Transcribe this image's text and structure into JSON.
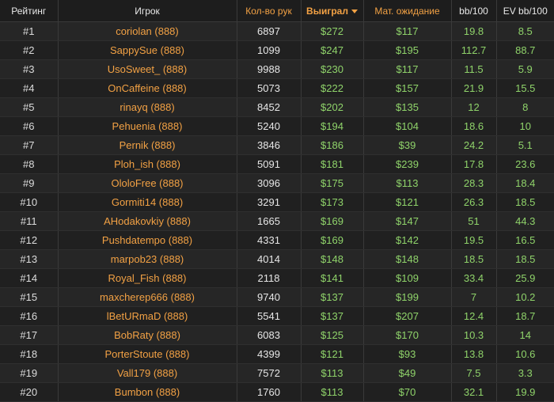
{
  "header": {
    "rank": "Рейтинг",
    "player": "Игрок",
    "hands": "Кол-во рук",
    "won": "Выиграл",
    "expected": "Мат. ожидание",
    "bb100": "bb/100",
    "ev_bb100": "EV bb/100"
  },
  "sort": {
    "column": "won",
    "direction": "desc"
  },
  "colors": {
    "background": "#232323",
    "accent_orange": "#f2a144",
    "money_green": "#8fd36a"
  },
  "rows": [
    {
      "rank": "#1",
      "player": "coriolan (888)",
      "hands": "6897",
      "won": "$272",
      "expected": "$117",
      "bb100": "19.8",
      "ev_bb100": "8.5"
    },
    {
      "rank": "#2",
      "player": "SappySue (888)",
      "hands": "1099",
      "won": "$247",
      "expected": "$195",
      "bb100": "112.7",
      "ev_bb100": "88.7"
    },
    {
      "rank": "#3",
      "player": "UsoSweet_ (888)",
      "hands": "9988",
      "won": "$230",
      "expected": "$117",
      "bb100": "11.5",
      "ev_bb100": "5.9"
    },
    {
      "rank": "#4",
      "player": "OnCaffeine (888)",
      "hands": "5073",
      "won": "$222",
      "expected": "$157",
      "bb100": "21.9",
      "ev_bb100": "15.5"
    },
    {
      "rank": "#5",
      "player": "rinayq (888)",
      "hands": "8452",
      "won": "$202",
      "expected": "$135",
      "bb100": "12",
      "ev_bb100": "8"
    },
    {
      "rank": "#6",
      "player": "Pehuenia (888)",
      "hands": "5240",
      "won": "$194",
      "expected": "$104",
      "bb100": "18.6",
      "ev_bb100": "10"
    },
    {
      "rank": "#7",
      "player": "Pernik (888)",
      "hands": "3846",
      "won": "$186",
      "expected": "$39",
      "bb100": "24.2",
      "ev_bb100": "5.1"
    },
    {
      "rank": "#8",
      "player": "Ploh_ish (888)",
      "hands": "5091",
      "won": "$181",
      "expected": "$239",
      "bb100": "17.8",
      "ev_bb100": "23.6"
    },
    {
      "rank": "#9",
      "player": "OloloFree (888)",
      "hands": "3096",
      "won": "$175",
      "expected": "$113",
      "bb100": "28.3",
      "ev_bb100": "18.4"
    },
    {
      "rank": "#10",
      "player": "Gormiti14 (888)",
      "hands": "3291",
      "won": "$173",
      "expected": "$121",
      "bb100": "26.3",
      "ev_bb100": "18.5"
    },
    {
      "rank": "#11",
      "player": "AHodakovkiy (888)",
      "hands": "1665",
      "won": "$169",
      "expected": "$147",
      "bb100": "51",
      "ev_bb100": "44.3"
    },
    {
      "rank": "#12",
      "player": "Pushdatempo (888)",
      "hands": "4331",
      "won": "$169",
      "expected": "$142",
      "bb100": "19.5",
      "ev_bb100": "16.5"
    },
    {
      "rank": "#13",
      "player": "marpob23 (888)",
      "hands": "4014",
      "won": "$148",
      "expected": "$148",
      "bb100": "18.5",
      "ev_bb100": "18.5"
    },
    {
      "rank": "#14",
      "player": "Royal_Fish (888)",
      "hands": "2118",
      "won": "$141",
      "expected": "$109",
      "bb100": "33.4",
      "ev_bb100": "25.9"
    },
    {
      "rank": "#15",
      "player": "maxcherep666 (888)",
      "hands": "9740",
      "won": "$137",
      "expected": "$199",
      "bb100": "7",
      "ev_bb100": "10.2"
    },
    {
      "rank": "#16",
      "player": "lBetURmaD (888)",
      "hands": "5541",
      "won": "$137",
      "expected": "$207",
      "bb100": "12.4",
      "ev_bb100": "18.7"
    },
    {
      "rank": "#17",
      "player": "BobRaty (888)",
      "hands": "6083",
      "won": "$125",
      "expected": "$170",
      "bb100": "10.3",
      "ev_bb100": "14"
    },
    {
      "rank": "#18",
      "player": "PorterStoute (888)",
      "hands": "4399",
      "won": "$121",
      "expected": "$93",
      "bb100": "13.8",
      "ev_bb100": "10.6"
    },
    {
      "rank": "#19",
      "player": "Vall179 (888)",
      "hands": "7572",
      "won": "$113",
      "expected": "$49",
      "bb100": "7.5",
      "ev_bb100": "3.3"
    },
    {
      "rank": "#20",
      "player": "Bumbon (888)",
      "hands": "1760",
      "won": "$113",
      "expected": "$70",
      "bb100": "32.1",
      "ev_bb100": "19.9"
    }
  ]
}
